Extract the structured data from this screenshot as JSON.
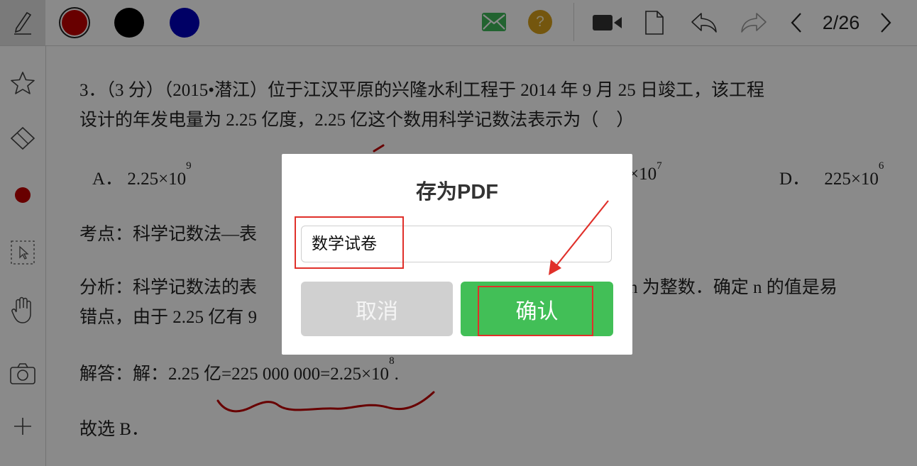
{
  "toolbar": {
    "pen_tool": "pencil-icon",
    "colors": [
      "#c00000",
      "#000000",
      "#0000bb"
    ],
    "selected_color": "#c00000",
    "mail_icon": "mail-icon",
    "help_label": "?",
    "video_icon": "video-camera-icon",
    "new_page_icon": "new-page-icon",
    "undo_icon": "undo-icon",
    "redo_icon": "redo-icon",
    "page_indicator": "2/26"
  },
  "sidebar": {
    "items": [
      "star-icon",
      "eraser-icon",
      "record-dot-icon",
      "select-icon",
      "hand-icon",
      "camera-icon",
      "plus-icon"
    ]
  },
  "document": {
    "question_line1": "3．（3 分）（2015•潜江）位于江汉平原的兴隆水利工程于 2014 年 9 月 25 日竣工，该工程",
    "question_line2": "设计的年发电量为 2.25 亿度，2.25 亿这个数用科学记数法表示为（　）",
    "option_a_label": "A．",
    "option_a_base": "2.25×10",
    "option_a_exp": "9",
    "option_c_base": "×10",
    "option_c_exp": "7",
    "option_d_label": "D．",
    "option_d_base": "225×10",
    "option_d_exp": "6",
    "kaodian": "考点：科学记数法—表",
    "fenxi_line1_start": "分析：科学记数法的表",
    "fenxi_line1_end": "n 为整数．确定 n 的值是易",
    "fenxi_line2": "错点，由于 2.25 亿有 9",
    "jieda_base": "解答：解：2.25 亿=225 000 000=2.25×10",
    "jieda_exp": "8",
    "jieda_end": ".",
    "conclusion": "故选 B．"
  },
  "dialog": {
    "title": "存为PDF",
    "filename_value": "数学试卷",
    "cancel_label": "取消",
    "confirm_label": "确认"
  },
  "colors": {
    "confirm_button": "#42bf57",
    "cancel_button": "#d0d0d0",
    "annotation_red": "#e0302a",
    "ink_red": "#c00000"
  }
}
